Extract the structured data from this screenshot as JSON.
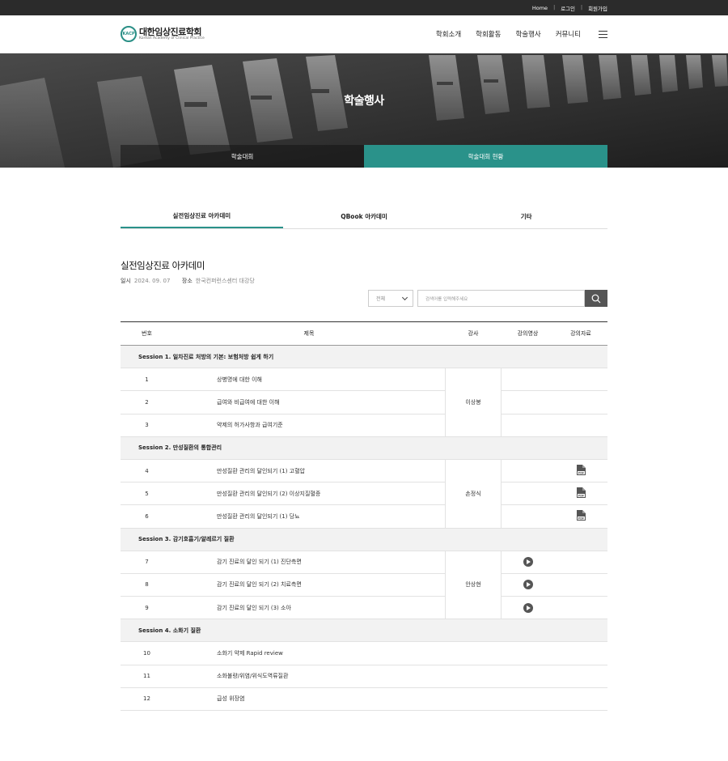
{
  "topbar": {
    "home": "Home",
    "login": "로그인",
    "join": "회원가입",
    "separator": "|"
  },
  "logo": {
    "mark": "KACP",
    "name_ko": "대한임상진료학회",
    "name_en": "Korean Academy of Clinical Practice"
  },
  "gnb": [
    "학회소개",
    "학회활동",
    "학술행사",
    "커뮤니티"
  ],
  "hero": {
    "title": "학술행사",
    "tabs": [
      "학술대회",
      "학술대회 현황"
    ]
  },
  "subtabs": [
    "실전임상진료 아카데미",
    "QBook 아카데미",
    "기타"
  ],
  "event": {
    "title": "실전임상진료 아카데미",
    "date_label": "일시",
    "date": "2024. 09. 07",
    "place_label": "장소",
    "place": "한국컨퍼런스센터 대강당"
  },
  "search": {
    "select_value": "전체",
    "placeholder": "검색어를 입력해주세요"
  },
  "table": {
    "headers": [
      "번호",
      "제목",
      "강사",
      "강의영상",
      "강의자료"
    ],
    "sessions": [
      {
        "title": "Session 1. 일차진료 처방의 기본: 보험처방 쉽게 하기",
        "lecturer": "이상봉",
        "rows": [
          {
            "no": "1",
            "title": "상병명에 대한 이해",
            "video": false,
            "pdf": false
          },
          {
            "no": "2",
            "title": "급여와 비급여에 대한 이해",
            "video": false,
            "pdf": false
          },
          {
            "no": "3",
            "title": "약제의 허가사항과 급여기준",
            "video": false,
            "pdf": false
          }
        ]
      },
      {
        "title": "Session 2. 만성질환의 통합관리",
        "lecturer": "손정식",
        "rows": [
          {
            "no": "4",
            "title": "만성질환 관리의 달인되기 (1) 고혈압",
            "video": false,
            "pdf": true
          },
          {
            "no": "5",
            "title": "만성질환 관리의 달인되기 (2) 이상지질혈증",
            "video": false,
            "pdf": true
          },
          {
            "no": "6",
            "title": "만성질환 관리의 달인되기 (1) 당뇨",
            "video": false,
            "pdf": true
          }
        ]
      },
      {
        "title": "Session 3. 감기호흡기/알레르기 질환",
        "lecturer": "안상현",
        "rows": [
          {
            "no": "7",
            "title": "감기 진료의 달인 되기 (1) 진단측면",
            "video": true,
            "pdf": false
          },
          {
            "no": "8",
            "title": "감기 진료의 달인 되기 (2) 치료측면",
            "video": true,
            "pdf": false
          },
          {
            "no": "9",
            "title": "감기 진료의 달인 되기 (3) 소아",
            "video": true,
            "pdf": false
          }
        ]
      },
      {
        "title": "Session 4. 소화기 질환",
        "lecturer": "",
        "rows": [
          {
            "no": "10",
            "title": "소화기 약제 Rapid review",
            "video": false,
            "pdf": false
          },
          {
            "no": "11",
            "title": "소화불량/위염/위식도역류질환",
            "video": false,
            "pdf": false
          },
          {
            "no": "12",
            "title": "급성 위장염",
            "video": false,
            "pdf": false
          }
        ]
      }
    ]
  },
  "colors": {
    "accent": "#2a928a",
    "topbar": "#2b2b2b",
    "session_bg": "#f2f2f2"
  },
  "icons": {
    "menu": "hamburger-icon",
    "search": "magnifier-icon",
    "video": "play-icon",
    "material": "pdf-icon",
    "select": "chevron-down-icon"
  }
}
